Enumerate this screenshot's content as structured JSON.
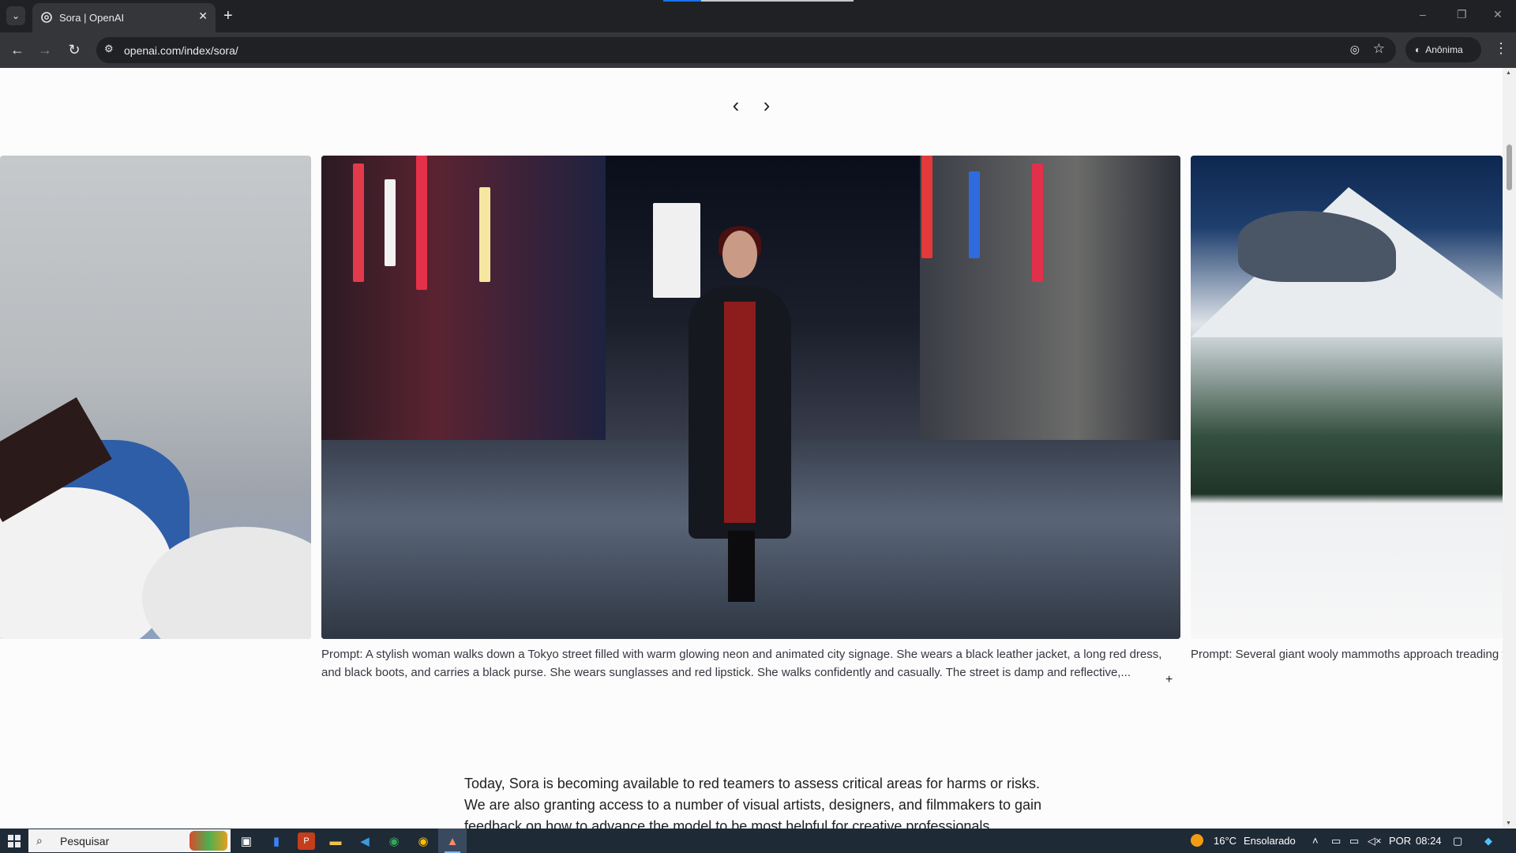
{
  "browser": {
    "tab_title": "Sora | OpenAI",
    "new_tab_symbol": "+",
    "url": "openai.com/index/sora/",
    "incognito_label": "Anônima",
    "window_controls": [
      "–",
      "❐",
      "✕"
    ]
  },
  "icons": {
    "tab_list": "chevron-down-icon",
    "favicon": "openai-logo-icon",
    "tab_close": "close-icon",
    "back": "arrow-left-icon",
    "forward": "arrow-right-icon",
    "reload": "reload-icon",
    "site_info": "tune-icon",
    "eye_off": "eye-off-icon",
    "bookmark": "star-icon",
    "incognito": "incognito-icon",
    "menu": "kebab-icon"
  },
  "carousel": {
    "prev_symbol": "‹",
    "next_symbol": "›",
    "main_caption": "Prompt: A stylish woman walks down a Tokyo street filled with warm glowing neon and animated city signage. She wears a black leather jacket, a long red dress, and black boots, and carries a black purse. She wears sunglasses and red lipstick. She walks confidently and casually. The street is damp and reflective,...",
    "right_caption": "Prompt: Several giant wooly mammoths approach treading through a snowy meadow, their long wooly fur lightly blows in the wind as they walk, snow covered trees and dramatic snow capped mountains in the distance",
    "expand_symbol": "+"
  },
  "body": {
    "paragraph": "Today, Sora is becoming available to red teamers to assess critical areas for harms or risks. We are also granting access to a number of visual artists, designers, and filmmakers to gain feedback on how to advance the model to be most helpful for creative professionals."
  },
  "taskbar": {
    "search_placeholder": "Pesquisar",
    "temperature": "16°C",
    "weather": "Ensolarado",
    "language": "POR",
    "time": "08:24"
  },
  "colors": {
    "chrome_dark": "#202124",
    "chrome_toolbar": "#35363a",
    "page_bg": "#fcfcfc",
    "taskbar_bg": "#1f2a37",
    "load_accent": "#1a73e8"
  }
}
